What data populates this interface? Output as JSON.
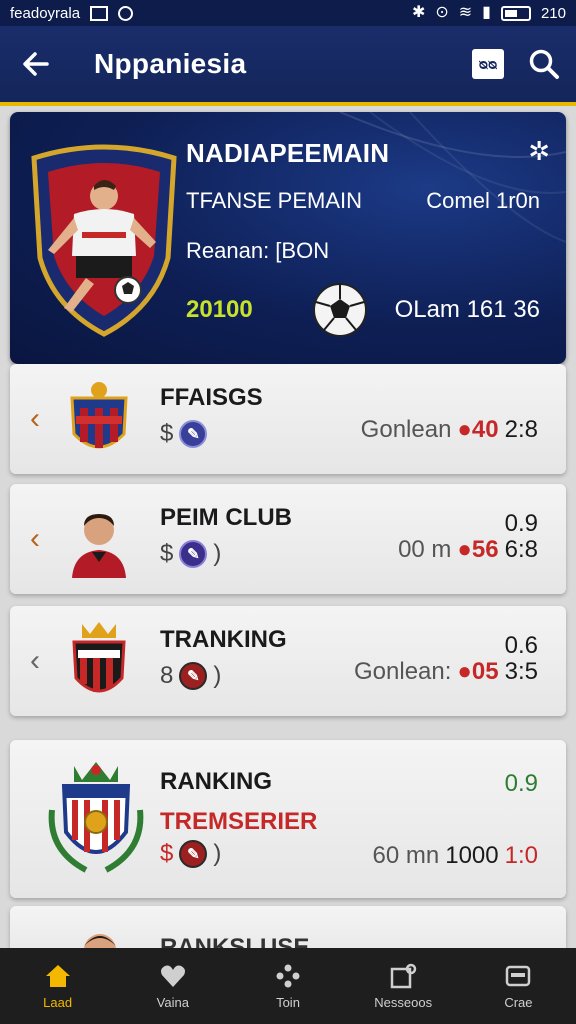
{
  "status": {
    "left_text": "feadoyrala",
    "time": "210"
  },
  "app_bar": {
    "back_icon": "arrow-left-icon",
    "title": "Nppaniesia",
    "action_label": "ᴓᴓ",
    "search_icon": "search-icon"
  },
  "featured": {
    "title": "NADIAPEEMAIN",
    "subtitle": "TFANSE PEMAIN",
    "right_label": "Comel 1r0n",
    "season": "Reanan: [BON",
    "points": "20100",
    "stats": "OLam 161  36",
    "close_icon": "close-icon"
  },
  "clubs": [
    {
      "name": "FFAISGS",
      "subname": "",
      "sub_prefix": "$",
      "coin_color": "#3a3f9a",
      "right_top": "",
      "right_label": "Gonlean",
      "score_red": "40",
      "score": "2:8",
      "chevron_color": "#b5651d"
    },
    {
      "name": "PEIM CLUB",
      "subname": "",
      "sub_prefix": "$",
      "coin_suffix": ")",
      "coin_color": "#3a2f8a",
      "right_top": "0.9",
      "right_label": "00 m",
      "score_red": "56",
      "score": "6:8",
      "chevron_color": "#b5651d"
    },
    {
      "name": "TRANKING",
      "subname": "",
      "sub_prefix": "8",
      "coin_suffix": ")",
      "coin_color": "#9c2020",
      "right_top": "0.6",
      "right_label": "Gonlean:",
      "score_red": "05",
      "score": "3:5",
      "chevron_color": "#666666"
    },
    {
      "name": "RANKING",
      "subname": "TREMSERIER",
      "sub_prefix": "$",
      "coin_suffix": ")",
      "coin_color": "#9c2020",
      "right_top": "0.9",
      "right_label": "60 mn",
      "score_red": "",
      "score": "1000",
      "score_tail": "1:0",
      "chevron_color": ""
    },
    {
      "name": "RANKSLUSE",
      "subname": "",
      "sub_prefix": "",
      "right_top": "",
      "right_label": "",
      "score_red": "",
      "score": "",
      "chevron_color": ""
    }
  ],
  "nav": [
    {
      "label": "Laad",
      "icon": "home-icon",
      "active": true
    },
    {
      "label": "Vaina",
      "icon": "heart-icon",
      "active": false
    },
    {
      "label": "Toin",
      "icon": "team-icon",
      "active": false
    },
    {
      "label": "Nesseoos",
      "icon": "news-icon",
      "active": false
    },
    {
      "label": "Crae",
      "icon": "card-icon",
      "active": false
    }
  ],
  "colors": {
    "appbar": "#14255a",
    "accent_gold": "#e6b800",
    "points_green": "#c6e22a",
    "score_red": "#c62828",
    "nav_active": "#f2b900"
  }
}
